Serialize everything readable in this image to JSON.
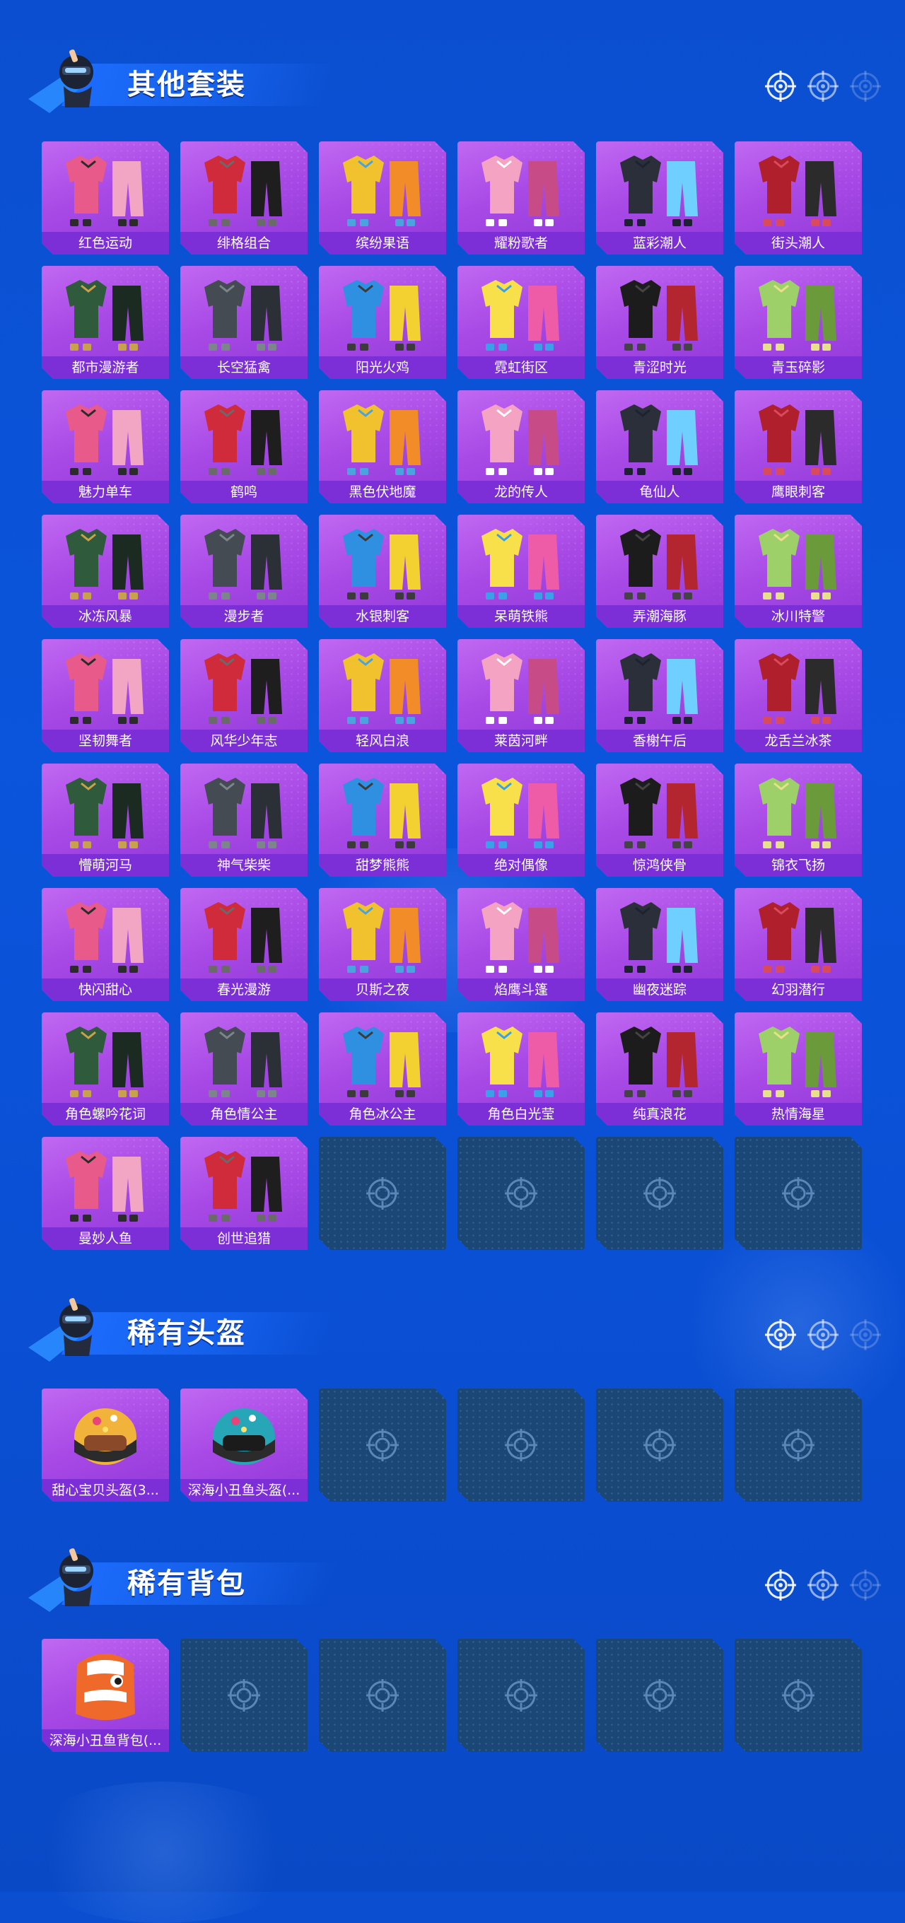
{
  "colors": {
    "background": "#0a55dc",
    "tile_purple": "#a94ae6",
    "label_purple": "#7c2fd6",
    "empty_slot": "#1a4775"
  },
  "icons": {
    "mascot": "soldier-mascot-icon",
    "reticle": "crosshair-reticle-icon",
    "empty_slot": "crosshair-emblem-icon"
  },
  "sections": [
    {
      "id": "other-sets",
      "title": "其他套装",
      "items": [
        "红色运动",
        "绯格组合",
        "缤纷果语",
        "耀粉歌者",
        "蓝彩潮人",
        "街头潮人",
        "都市漫游者",
        "长空猛禽",
        "阳光火鸡",
        "霓虹街区",
        "青涩时光",
        "青玉碎影",
        "魅力单车",
        "鹤鸣",
        "黑色伏地魔",
        "龙的传人",
        "龟仙人",
        "鹰眼刺客",
        "冰冻风暴",
        "漫步者",
        "水银刺客",
        "呆萌铁熊",
        "弄潮海豚",
        "冰川特警",
        "坚韧舞者",
        "风华少年志",
        "轻风白浪",
        "莱茵河畔",
        "香榭午后",
        "龙舌兰冰茶",
        "懵萌河马",
        "神气柴柴",
        "甜梦熊熊",
        "绝对偶像",
        "惊鸿侠骨",
        "锦衣飞扬",
        "快闪甜心",
        "春光漫游",
        "贝斯之夜",
        "焰鹰斗篷",
        "幽夜迷踪",
        "幻羽潜行",
        "角色螺吟花词",
        "角色情公主",
        "角色冰公主",
        "角色白光莹",
        "纯真浪花",
        "热情海星",
        "曼妙人鱼",
        "创世追猎"
      ],
      "empty_slots": 4
    },
    {
      "id": "rare-helmets",
      "title": "稀有头盔",
      "items": [
        "甜心宝贝头盔(3...",
        "深海小丑鱼头盔(..."
      ],
      "empty_slots": 4
    },
    {
      "id": "rare-backpacks",
      "title": "稀有背包",
      "items": [
        "深海小丑鱼背包(..."
      ],
      "empty_slots": 5
    }
  ]
}
